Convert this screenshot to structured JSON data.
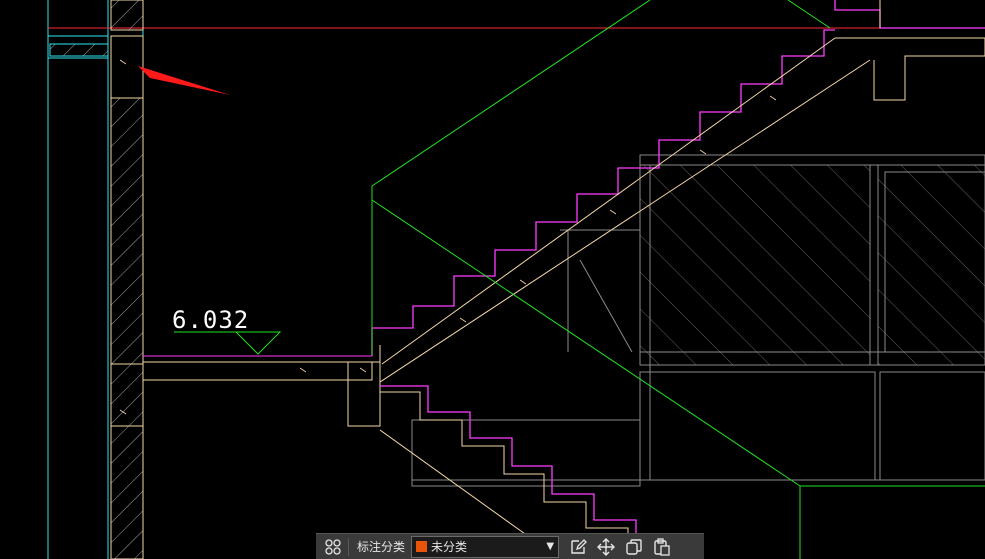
{
  "drawing": {
    "elevation_text": "6.032",
    "colors": {
      "background": "#000000",
      "wall_outline": "#f5d7a8",
      "stair_outline": "#ff3cff",
      "section_green": "#22e022",
      "grid_cyan": "#2ee6ee",
      "red_line": "#ff2a3a",
      "arrow_red": "#ff1a1a",
      "grey": "#8a8a8a",
      "dimension_white": "#ffffff"
    }
  },
  "toolbar": {
    "grid_icon": "grid-icon",
    "category_label": "标注分类",
    "category_value": "未分类",
    "category_color": "#e8540a",
    "dropdown_icon": "chevron-down-icon",
    "edit_icon": "edit-icon",
    "move_icon": "move-icon",
    "copy_icon": "copy-icon",
    "paste_icon": "paste-icon"
  }
}
